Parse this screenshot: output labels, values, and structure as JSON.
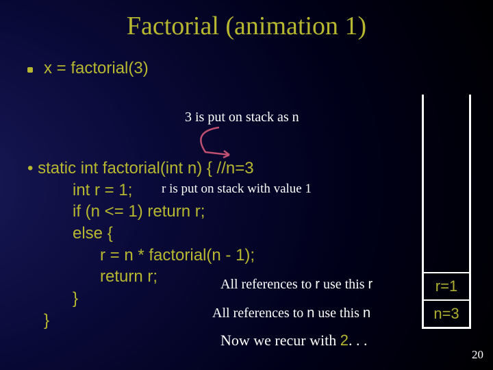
{
  "title": "Factorial (animation 1)",
  "bullet1": "x = factorial(3)",
  "annot1": "3 is put on stack as n",
  "code": {
    "l0_a": "• ",
    "l0_b": "static int factorial(int ",
    "l0_c": "n",
    "l0_d": ") { //",
    "l0_e": "n=3",
    "l1": "int r = 1;",
    "l2": "if (n <= 1) return r;",
    "l3": "else {",
    "l4": "r = n * factorial(n - 1);",
    "l5": "return r;",
    "l6": "}",
    "l7": "}"
  },
  "annot2": "r is put on stack with value 1",
  "annot3_a": "All references to ",
  "annot3_b": "r",
  "annot3_c": " use this ",
  "annot3_d": "r",
  "annot4_a": "All references to ",
  "annot4_b": "n",
  "annot4_c": " use this ",
  "annot4_d": "n",
  "annot5_a": "Now we recur with ",
  "annot5_b": "2",
  "annot5_c": ". . .",
  "stack": {
    "top": "r=1",
    "bottom": "n=3"
  },
  "pagenum": "20"
}
